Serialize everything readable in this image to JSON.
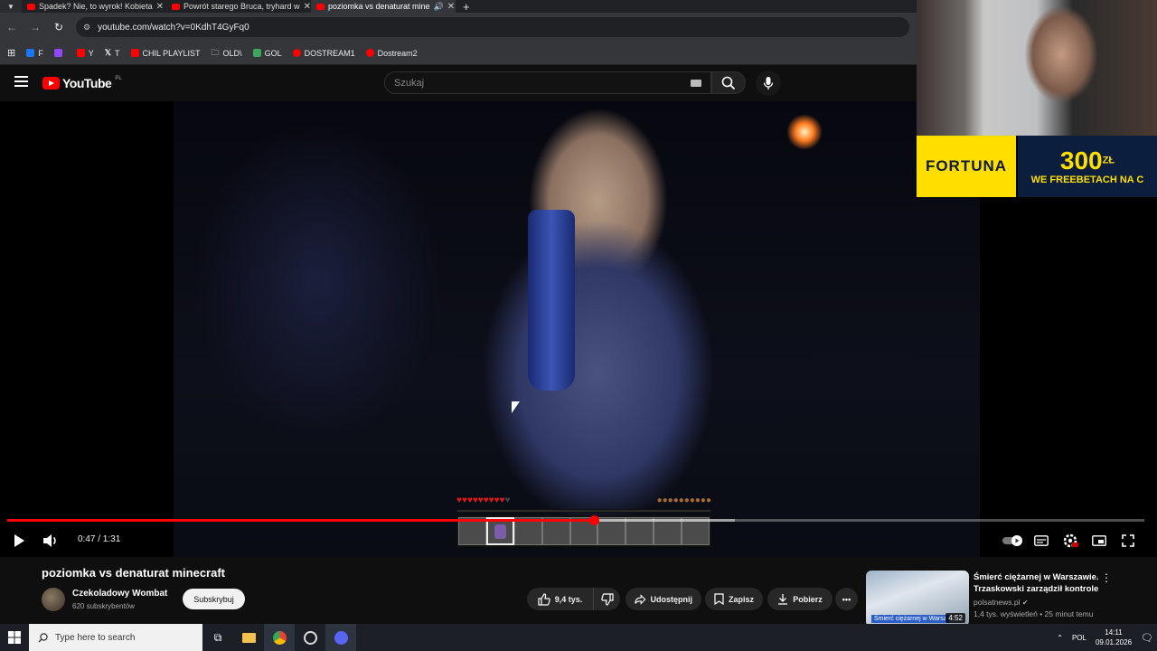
{
  "browser": {
    "tabs": [
      {
        "title": "Spadek? Nie, to wyrok! Kobieta",
        "active": false
      },
      {
        "title": "Powrót starego Bruca, tryhard w",
        "active": false
      },
      {
        "title": "poziomka vs denaturat mine",
        "active": true
      }
    ],
    "new_tab_label": "+",
    "url": "youtube.com/watch?v=0KdhT4GyFq0",
    "bookmarks": [
      {
        "label": "F",
        "color": "#1877f2"
      },
      {
        "label": "",
        "color": "#9146ff"
      },
      {
        "label": "Y",
        "color": "#ff0000"
      },
      {
        "label": "T",
        "color": "#ffffff"
      },
      {
        "label": "CHIL PLAYLIST",
        "color": "#ff0000"
      },
      {
        "label": "OLD\\",
        "color": "#e8eaed"
      },
      {
        "label": "GOL",
        "color": "#3ba55c"
      },
      {
        "label": "DOSTREAM1",
        "color": "#ff0000"
      },
      {
        "label": "Dostream2",
        "color": "#ff0000"
      }
    ]
  },
  "youtube": {
    "logo_text": "YouTube",
    "region": "PL",
    "search_placeholder": "Szukaj"
  },
  "player": {
    "time": "0:47 / 1:31",
    "progress": 0.516,
    "buffered": 0.64,
    "hud": {
      "hearts_full": 9,
      "hearts_total": 10,
      "food_total": 10,
      "hotbar_slots": 9,
      "selected_slot": 1
    }
  },
  "ad": {
    "brand": "FORTUNA",
    "amount": "300",
    "currency": "ZŁ",
    "tagline": "WE FREEBETACH NA C"
  },
  "video": {
    "title": "poziomka vs denaturat minecraft",
    "channel": "Czekoladowy Wombat",
    "subscribers": "620 subskrybentów",
    "subscribe_label": "Subskrybuj",
    "likes": "9,4 tys.",
    "share_label": "Udostępnij",
    "save_label": "Zapisz",
    "download_label": "Pobierz"
  },
  "recommended": {
    "title": "Śmierć ciężarnej w Warszawie. Trzaskowski zarządził kontrole",
    "source": "polsatnews.pl",
    "meta": "1,4 tys. wyświetleń • 25 minut temu",
    "duration": "4:52",
    "caption": "Śmierć ciężarnej w Warsz"
  },
  "taskbar": {
    "search_placeholder": "Type here to search",
    "lang": "POL",
    "time": "14:11",
    "date": "09.01.2026"
  }
}
